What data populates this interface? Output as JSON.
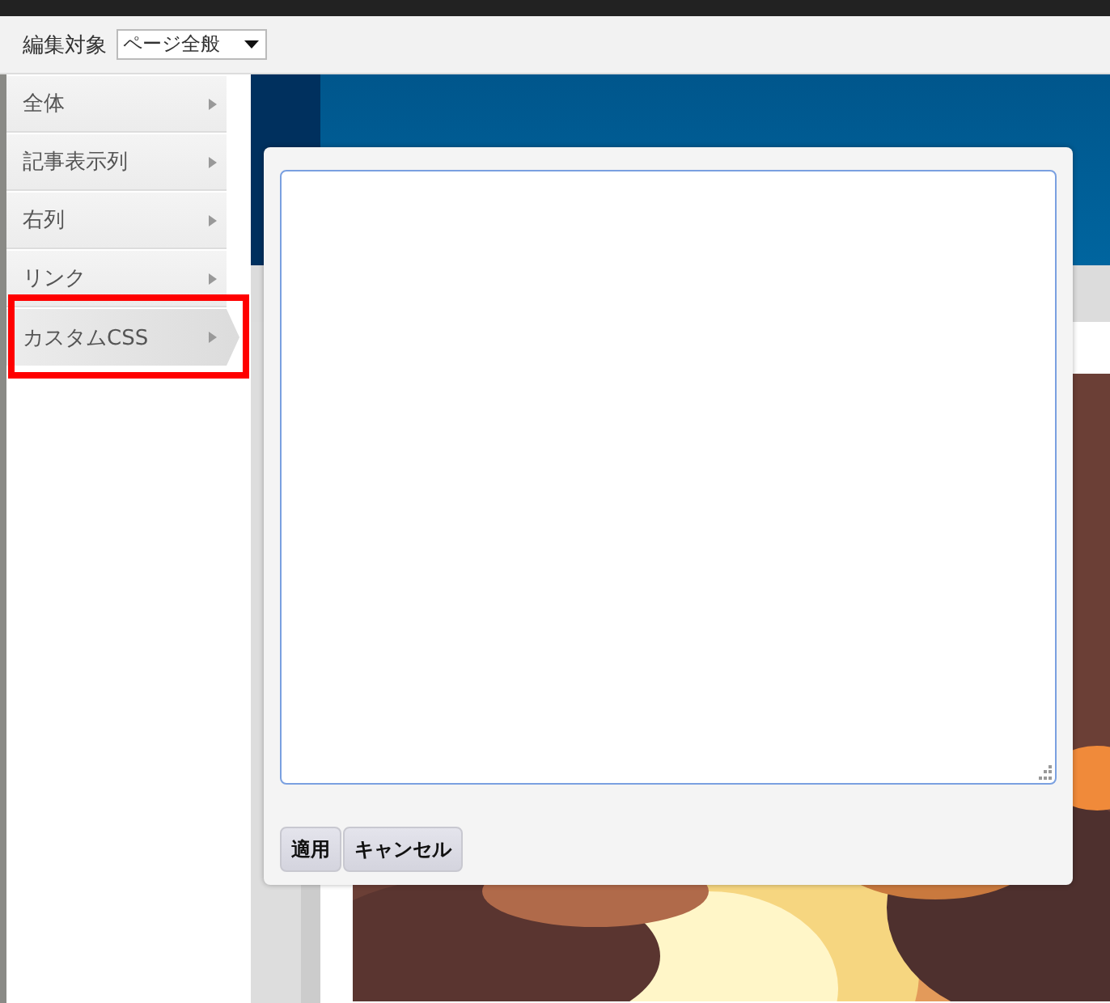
{
  "toolbar": {
    "label": "編集対象",
    "target_select": {
      "value": "ページ全般"
    }
  },
  "menu": [
    {
      "label": "全体",
      "selected": false,
      "highlighted": false
    },
    {
      "label": "記事表示列",
      "selected": false,
      "highlighted": false
    },
    {
      "label": "右列",
      "selected": false,
      "highlighted": false
    },
    {
      "label": "リンク",
      "selected": false,
      "highlighted": false
    },
    {
      "label": "カスタムCSS",
      "selected": true,
      "highlighted": true
    }
  ],
  "dialog": {
    "buttons": [
      "適用",
      "キャンセル"
    ]
  }
}
